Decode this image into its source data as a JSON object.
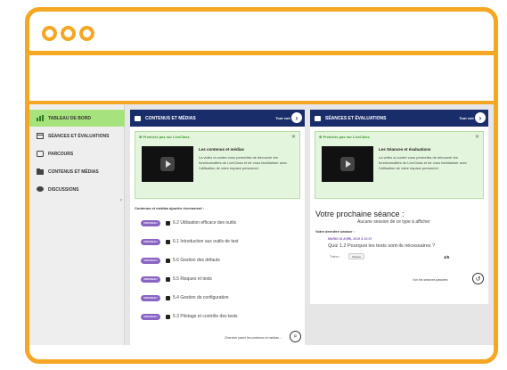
{
  "sidebar": {
    "items": [
      {
        "label": "Tableau de bord",
        "icon": "bar-chart-icon"
      },
      {
        "label": "Séances et évaluations",
        "icon": "calendar-icon"
      },
      {
        "label": "Parcours",
        "icon": "path-icon"
      },
      {
        "label": "Contenus et médias",
        "icon": "folder-icon"
      },
      {
        "label": "Discussions",
        "icon": "chat-icon"
      }
    ],
    "collapse_glyph": "‹"
  },
  "media_panel": {
    "title": "Contenus et médias",
    "see_all": "Tout voir",
    "arrow": "›",
    "promo": {
      "tag": "⊕ Premiers pas sur LiveClass",
      "close": "✕",
      "heading": "Les contenus et médias",
      "description": "La vidéo ci-contre vous permettra de découvrir les fonctionnalités de LiveClass et de vous familiariser avec l'utilisation de votre espace personnel."
    },
    "recent_label": "Contenus et médias ajoutés récemment :",
    "badge": "NOUVEAU",
    "items": [
      "6.2 Utilisation efficace des outils",
      "6.1 Introduction aux outils de test",
      "5.6 Gestion des défauts",
      "5.5 Risques et tests",
      "5.4 Gestion de configuration",
      "5.3 Pilotage et contrôle des tests"
    ],
    "search_link": "Chercher parmi les contenus et médias...",
    "search_glyph": "⌕"
  },
  "sessions_panel": {
    "title": "Séances et évaluations",
    "see_all": "Tout voir",
    "arrow": "›",
    "promo": {
      "tag": "⊕ Premiers pas sur LiveClass",
      "close": "✕",
      "heading": "Les Séances et évaluations",
      "description": "La vidéo ci-contre vous permettra de découvrir les fonctionnalités de LiveClass et de vous familiariser avec l'utilisation de votre espace personnel."
    },
    "next_title": "Votre prochaine séance :",
    "next_empty": "Aucune session de ce type à afficher",
    "last_label": "Votre dernière séance :",
    "last_date": "MARDI 16 AVRIL 2019 À 10:37",
    "quiz_title": "Quiz 1.2 Pourquoi les tests sont-ils nécessaires ?",
    "meta": "Tuteur :",
    "chip": "Passée",
    "score": "4/6",
    "past_link": "Voir les séances passées",
    "history_glyph": "↺"
  },
  "colors": {
    "frame": "#f5a623",
    "header": "#1a2d6b",
    "active": "#a7e37d",
    "badge": "#8a65c4"
  }
}
